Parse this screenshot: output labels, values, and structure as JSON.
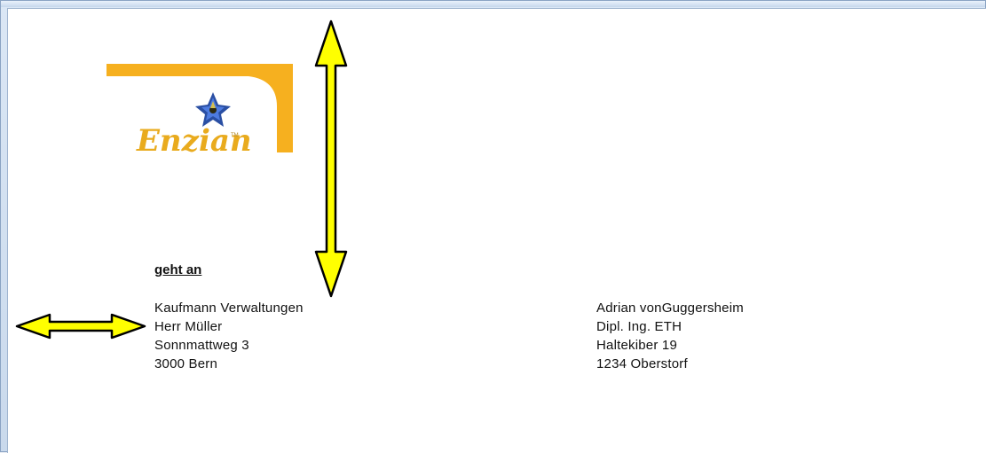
{
  "logo": {
    "text": "Enzian",
    "trademark": "TM",
    "colors": {
      "accent": "#f6b01f",
      "flower": "#2a4fa3"
    }
  },
  "heading": "geht an",
  "recipient": {
    "lines": [
      "Kaufmann Verwaltungen",
      "Herr Müller",
      "Sonnmattweg 3",
      "3000 Bern"
    ]
  },
  "sender": {
    "lines": [
      "Adrian vonGuggersheim",
      "Dipl. Ing. ETH",
      "Haltekiber 19",
      "1234 Oberstorf"
    ]
  },
  "annotations": {
    "arrow_color": "#ffff00",
    "arrows": [
      "vertical-double-arrow",
      "horizontal-double-arrow"
    ]
  }
}
